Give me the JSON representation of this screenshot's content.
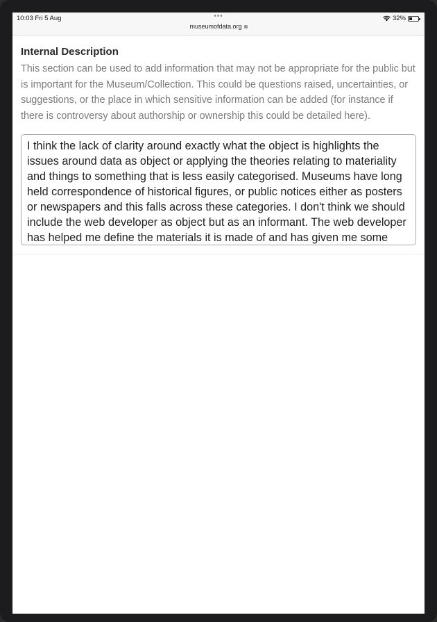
{
  "status_bar": {
    "time": "10:03  Fri 5 Aug",
    "dots": "•••",
    "url": "museumofdata.org",
    "battery": "32%"
  },
  "section": {
    "heading": "Internal Description",
    "help": "This section can be used to add information that may not be appropriate for the public but is important for the Museum/Collection. This could be questions raised, uncertainties, or suggestions, or the place in which sensitive information can be added (for instance if there is controversy about authorship or ownership this could be detailed here).",
    "value": "I think the lack of clarity around exactly what the object is highlights the issues around data as object or applying the theories relating to materiality and things to something that is less easily categorised. Museums have long held correspondence of historical figures, or public notices either as posters or newspapers and this falls across these categories. I don't think we should include the web developer as object but as an informant. The web developer has helped me define the materials it is made of and has given me some context to the object in the"
  }
}
